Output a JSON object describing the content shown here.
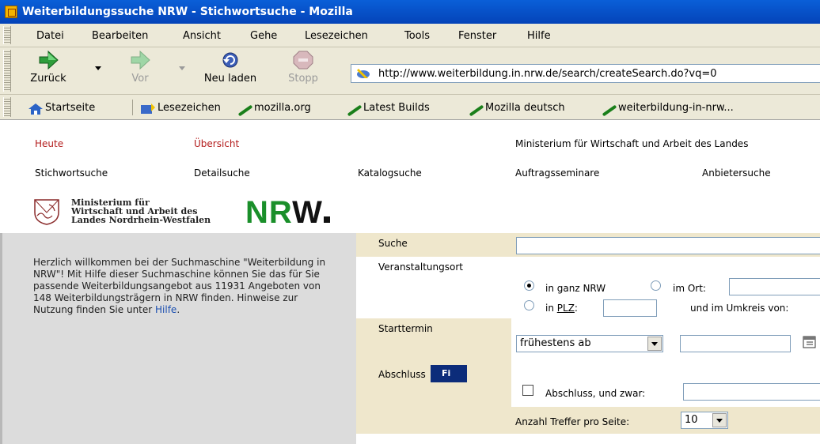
{
  "window": {
    "title": "Weiterbildungssuche NRW - Stichwortsuche - Mozilla"
  },
  "menu": [
    "Datei",
    "Bearbeiten",
    "Ansicht",
    "Gehe",
    "Lesezeichen",
    "Tools",
    "Fenster",
    "Hilfe"
  ],
  "nav": {
    "back": "Zurück",
    "forward": "Vor",
    "reload": "Neu laden",
    "stop": "Stopp"
  },
  "address": {
    "url": "http://www.weiterbildung.in.nrw.de/search/createSearch.do?vq=0"
  },
  "bookmarks": [
    "Startseite",
    "Lesezeichen",
    "mozilla.org",
    "Latest Builds",
    "Mozilla deutsch",
    "weiterbildung-in-nrw..."
  ],
  "page": {
    "top_links": {
      "heute": "Heute",
      "uebersicht": "Übersicht",
      "ministry": "Ministerium für Wirtschaft und Arbeit des Landes"
    },
    "tabs": [
      "Stichwortsuche",
      "Detailsuche",
      "Katalogsuche",
      "Auftragsseminare",
      "Anbietersuche"
    ],
    "logo": {
      "ministry_lines": [
        "Ministerium für",
        "Wirtschaft und Arbeit des",
        "Landes Nordrhein-Westfalen"
      ],
      "nrw": "NRW"
    },
    "welcome": {
      "text": "Herzlich willkommen bei der Suchmaschine \"Weiterbildung in NRW\"! Mit Hilfe dieser Suchmaschine können Sie das für Sie passende Weiterbildungsangebot aus 11931 Angeboten von 148 Weiterbildungsträgern in NRW finden. Hinweise zur Nutzung finden Sie unter ",
      "link": "Hilfe",
      "end": "."
    },
    "form": {
      "suche": "Suche",
      "ort": "Veranstaltungsort",
      "ganz_nrw": "in ganz NRW",
      "im_ort": "im Ort:",
      "in_plz_prefix": "in ",
      "in_plz_link": "PLZ",
      "in_plz_suffix": ":",
      "umkreis": "und im Umkreis von:",
      "starttermin": "Starttermin",
      "start_select": "frühestens ab",
      "abschluss": "Abschluss",
      "abschluss_chk": "Abschluss, und zwar:",
      "treffer": "Anzahl Treffer pro Seite:",
      "treffer_value": "10",
      "find_btn": "Fi"
    }
  }
}
